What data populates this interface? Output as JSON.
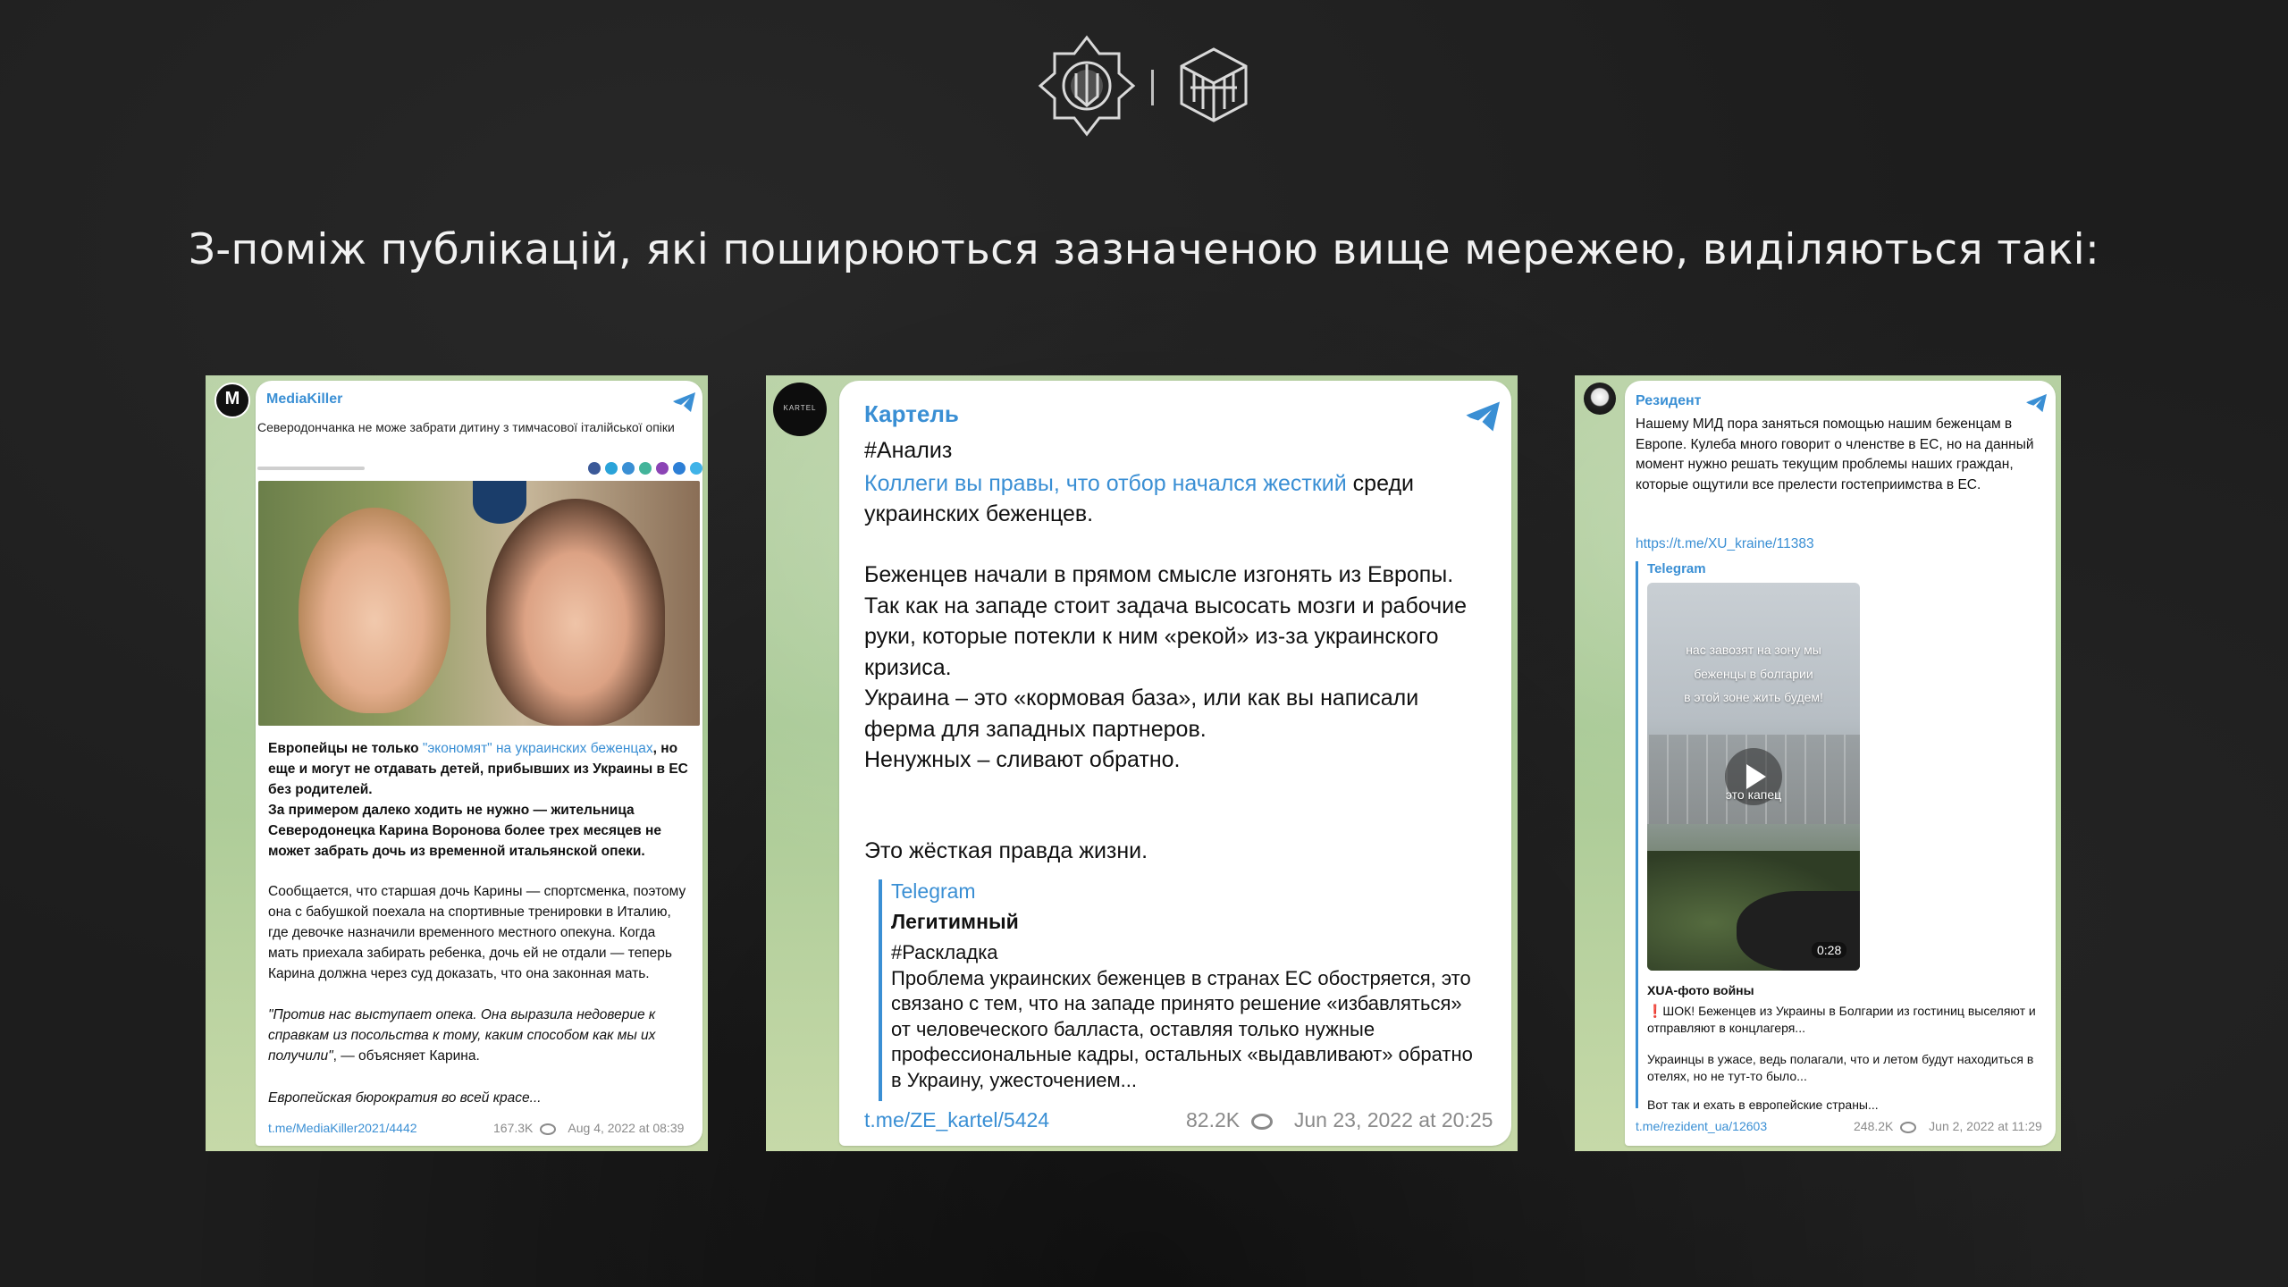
{
  "headline": "З-поміж публікацій, які поширюються зазначеною вище мережею, виділяються такі:",
  "icons": {
    "logo_left": "ukraine-trident-emblem-icon",
    "logo_right": "cube-emblem-icon",
    "telegram": "telegram-plane-icon",
    "views": "eye-icon"
  },
  "colors": {
    "link": "#3a8fd4",
    "background": "#1d1d1d",
    "chat_bg": "#a8c995"
  },
  "card1": {
    "channel": "MediaKiller",
    "avatar_letter": "M",
    "article_title": "Северодончанка не може забрати дитину з тимчасової італійської опіки",
    "lead_plain": "Европейцы не только ",
    "lead_link": "\"экономят\" на украинских беженцах",
    "lead_rest": ", но еще и могут не отдавать детей, прибывших из Украины в ЕС без родителей.\nЗа примером далеко ходить не нужно — жительница Северодонецка Карина Воронова более трех месяцев не может забрать дочь из временной итальянской опеки.",
    "body": "Сообщается, что старшая дочь Карины — спортсменка, поэтому она с бабушкой поехала на спортивные тренировки в Италию, где девочке назначили временного местного опекуна. Когда мать приехала забирать ребенка, дочь ей не отдали — теперь Карина должна через суд доказать, что она законная мать.",
    "quote_italic": "\"Против нас выступает опека. Она выразила недоверие к справкам из посольства к тому, каким способом как мы их получили\"",
    "quote_tail": ", — объясняет Карина.",
    "closing": "Европейская бюрократия во всей красе...",
    "link": "t.me/MediaKiller2021/4442",
    "views": "167.3K",
    "date": "Aug 4, 2022 at 08:39"
  },
  "card2": {
    "channel": "Картель",
    "avatar_text": "KARTEL",
    "hashtag": "#Анализ",
    "link_text": "Коллеги вы правы, что отбор начался жесткий",
    "after_link": " среди украинских беженцев.",
    "p1": "Беженцев начали в прямом смысле изгонять из Европы.\nТак как на западе стоит задача высосать мозги и рабочие руки, которые потекли к ним «рекой» из-за украинского кризиса.\nУкраина – это «кормовая база», или как вы написали ферма для западных партнеров.\nНенужных – сливают обратно.",
    "p2": "Это жёсткая правда жизни.",
    "quote_source": "Telegram",
    "quote_title": "Легитимный",
    "quote_text": "#Раскладка\nПроблема украинских беженцев в странах ЕС обостряется, это связано с тем, что на западе принято решение «избавляться» от человеческого балласта, оставляя только нужные профессиональные кадры, остальных «выдавливают» обратно в Украину, ужесточением...",
    "link": "t.me/ZE_kartel/5424",
    "views": "82.2K",
    "date": "Jun 23, 2022 at 20:25"
  },
  "card3": {
    "channel": "Резидент",
    "text": "Нашему МИД пора заняться помощью нашим беженцам в Европе. Кулеба много говорит о членстве в ЕС, но на данный момент нужно решать текущим проблемы наших граждан, которые ощутили все прелести гостеприимства в ЕС.",
    "url": "https://t.me/XU_kraine/11383",
    "quote_source": "Telegram",
    "video_overlay": "нас завозят на зону мы\nбеженцы в болгарии\nв этой зоне жить будем!",
    "video_overlay2": "это капец",
    "video_duration": "0:28",
    "quote_title": "XUA-фото войны",
    "quote_text": "❗ШОК! Беженцев из Украины в Болгарии из гостиниц выселяют и отправляют в концлагеря...",
    "quote_text2": "Украинцы в ужасе, ведь полагали, что и летом будут находиться в отелях, но не тут-то было...",
    "quote_text3": "Вот так и ехать в европейские страны...",
    "link": "t.me/rezident_ua/12603",
    "views": "248.2K",
    "date": "Jun 2, 2022 at 11:29"
  }
}
